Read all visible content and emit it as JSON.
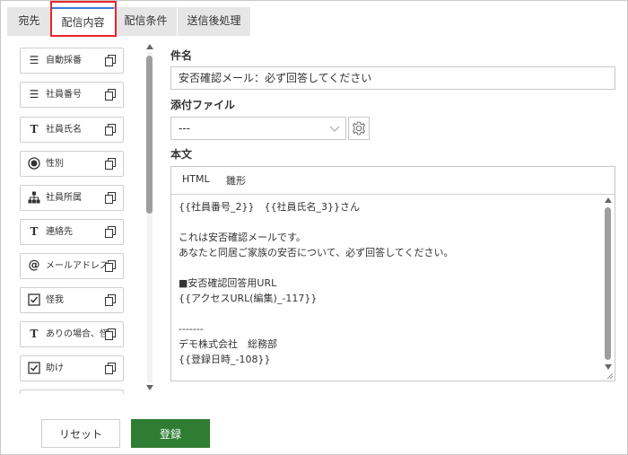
{
  "tabs": [
    {
      "label": "宛先"
    },
    {
      "label": "配信内容"
    },
    {
      "label": "配信条件"
    },
    {
      "label": "送信後処理"
    }
  ],
  "field_list": [
    {
      "label": "自動採番",
      "icon": "list-number-icon"
    },
    {
      "label": "社員番号",
      "icon": "list-number-icon"
    },
    {
      "label": "社員氏名",
      "icon": "text-icon"
    },
    {
      "label": "性別",
      "icon": "radio-icon"
    },
    {
      "label": "社員所属",
      "icon": "org-chart-icon"
    },
    {
      "label": "連絡先",
      "icon": "text-icon"
    },
    {
      "label": "メールアドレス",
      "icon": "at-icon"
    },
    {
      "label": "怪我",
      "icon": "checkbox-icon"
    },
    {
      "label": "ありの場合、怪",
      "icon": "text-icon"
    },
    {
      "label": "助け",
      "icon": "checkbox-icon"
    }
  ],
  "form": {
    "subject_label": "件名",
    "subject_value": "安否確認メール：必ず回答してください",
    "attachment_label": "添付ファイル",
    "attachment_value": "---",
    "body_label": "本文",
    "body_tabs": [
      "HTML",
      "雛形"
    ],
    "body_text": "{{社員番号_2}}　{{社員氏名_3}}さん\n\nこれは安否確認メールです。\nあなたと同居ご家族の安否について、必ず回答してください。\n\n■安否確認回答用URL\n{{アクセスURL(編集)_-117}}\n\n-------\nデモ株式会社　総務部\n{{登録日時_-108}}"
  },
  "buttons": {
    "reset": "リセット",
    "save": "登録"
  },
  "colors": {
    "tab_highlight": "#e8252a",
    "active_tab_accent": "#3a7bd5",
    "save_button": "#2e7d32"
  }
}
